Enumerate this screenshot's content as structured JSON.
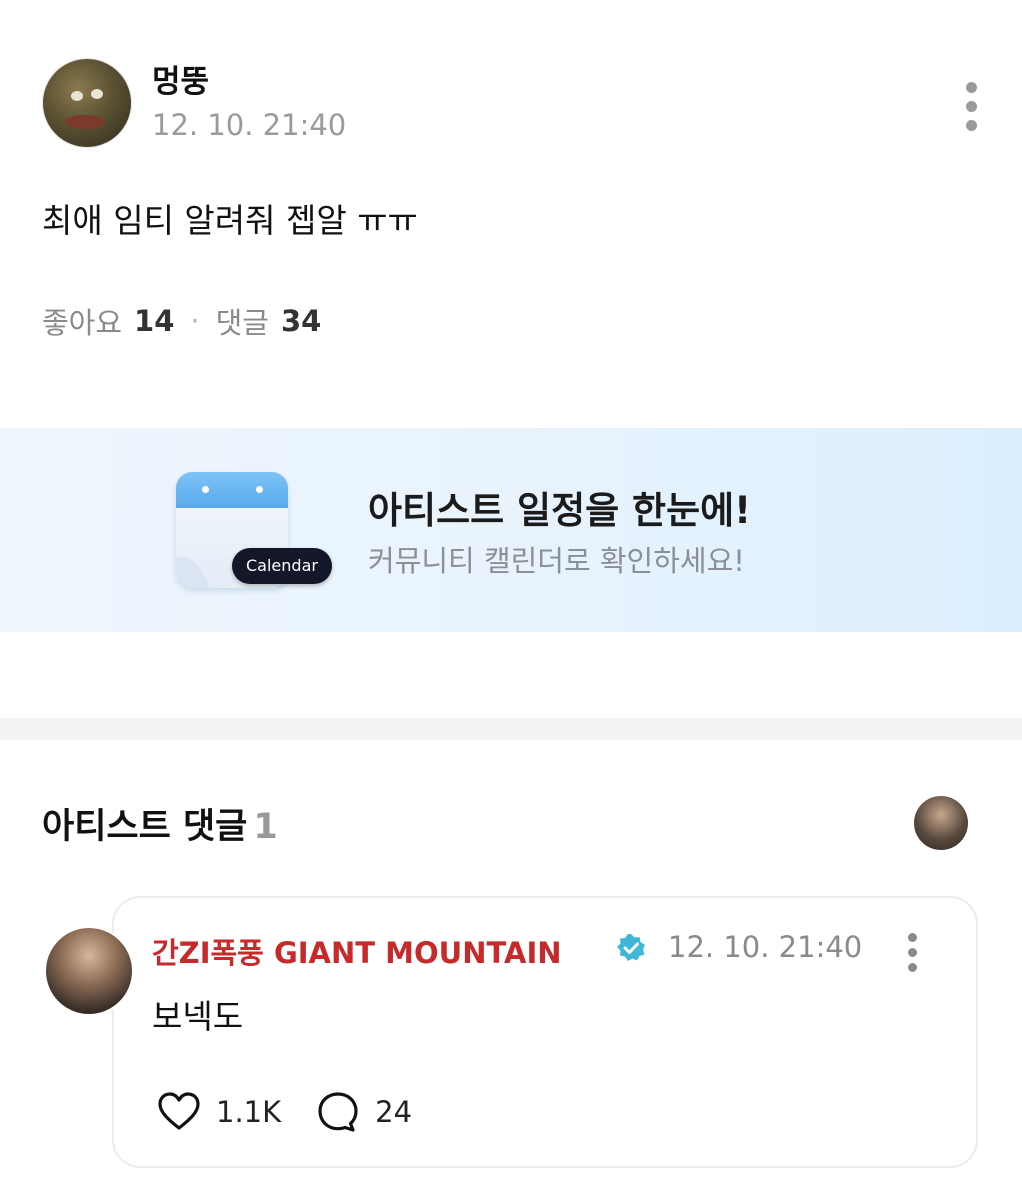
{
  "post": {
    "author": "멍뚱",
    "time": "12. 10. 21:40",
    "text": "최애 임티 알려줘 젭알 ㅠㅠ",
    "likes_label": "좋아요",
    "likes_count": "14",
    "separator": "·",
    "comments_label": "댓글",
    "comments_count": "34"
  },
  "banner": {
    "title": "아티스트 일정을 한눈에!",
    "subtitle": "커뮤니티 캘린더로 확인하세요!",
    "tag": "Calendar"
  },
  "artist_comments": {
    "title": "아티스트 댓글",
    "count": "1"
  },
  "comment": {
    "author": "간ZI폭풍 GIANT MOUNTAIN",
    "time": "12. 10. 21:40",
    "text": "보넥도",
    "likes": "1.1K",
    "replies": "24"
  },
  "colors": {
    "artist_name": "#c62a2a",
    "verified_badge": "#3fb8d8"
  },
  "icons": [
    "more-vertical-icon",
    "calendar-icon",
    "verified-badge-icon",
    "heart-icon",
    "comment-bubble-icon"
  ]
}
